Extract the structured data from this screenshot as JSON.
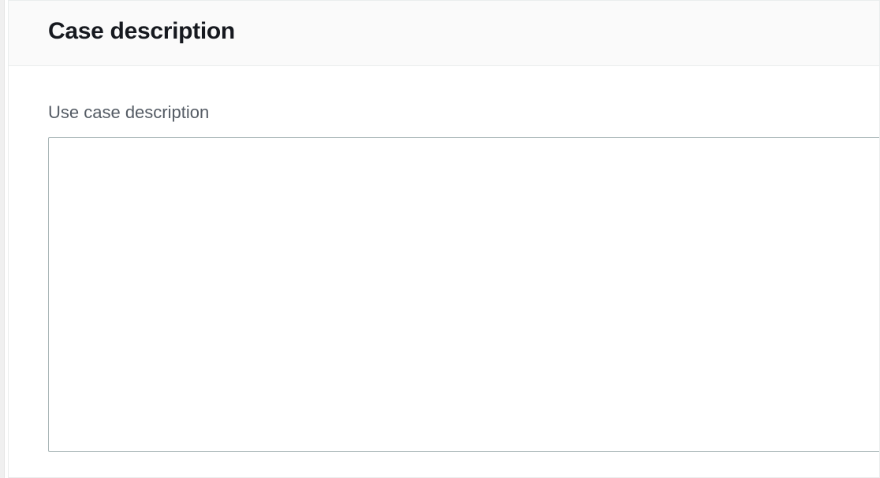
{
  "panel": {
    "title": "Case description"
  },
  "form": {
    "use_case_label": "Use case description",
    "use_case_value": ""
  }
}
